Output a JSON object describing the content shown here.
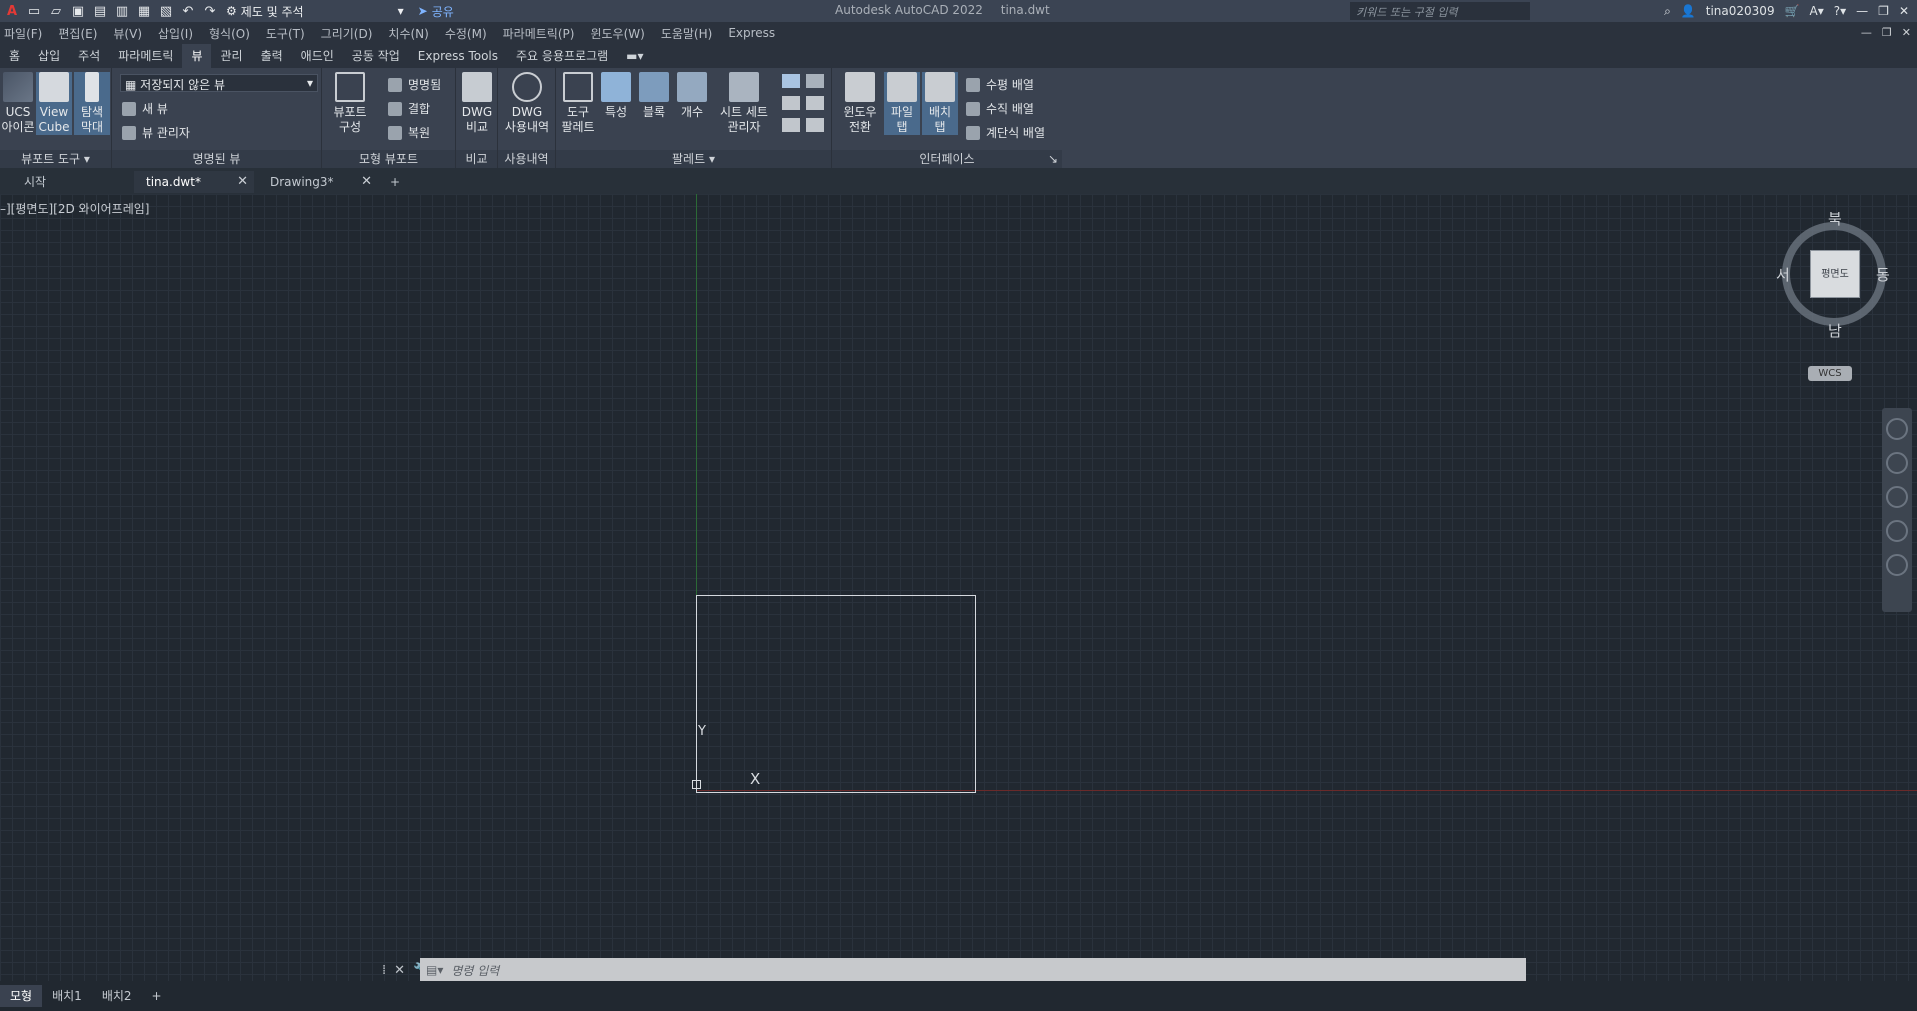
{
  "titlebar": {
    "workspace": "제도 및 주석",
    "share": "공유",
    "app_title": "Autodesk AutoCAD 2022",
    "file_title": "tina.dwt",
    "search_placeholder": "키워드 또는 구절 입력",
    "user": "tina020309"
  },
  "menu": [
    "파일(F)",
    "편집(E)",
    "뷰(V)",
    "삽입(I)",
    "형식(O)",
    "도구(T)",
    "그리기(D)",
    "치수(N)",
    "수정(M)",
    "파라메트릭(P)",
    "윈도우(W)",
    "도움말(H)",
    "Express"
  ],
  "ribbon_tabs": [
    {
      "label": "홈",
      "active": false
    },
    {
      "label": "삽입",
      "active": false
    },
    {
      "label": "주석",
      "active": false
    },
    {
      "label": "파라메트릭",
      "active": false
    },
    {
      "label": "뷰",
      "active": true
    },
    {
      "label": "관리",
      "active": false
    },
    {
      "label": "출력",
      "active": false
    },
    {
      "label": "애드인",
      "active": false
    },
    {
      "label": "공동 작업",
      "active": false
    },
    {
      "label": "Express Tools",
      "active": false
    },
    {
      "label": "주요 응용프로그램",
      "active": false
    }
  ],
  "ribbon": {
    "viewport_tools": {
      "title": "뷰포트 도구",
      "ucs_icon": "UCS\n아이콘",
      "view_cube": "View\nCube",
      "nav_bar": "탐색\n막대"
    },
    "named_views": {
      "title": "명명된 뷰",
      "combo": "저장되지 않은 뷰",
      "new_view": "새 뷰",
      "view_manager": "뷰 관리자"
    },
    "model_viewports": {
      "title": "모형 뷰포트",
      "config": "뷰포트\n구성",
      "named": "명명됨",
      "join": "결합",
      "restore": "복원"
    },
    "compare": {
      "title": "비교",
      "dwg_compare": "DWG\n비교"
    },
    "history": {
      "title": "사용내역",
      "dwg_history": "DWG\n사용내역"
    },
    "palettes": {
      "title": "팔레트",
      "tool_palettes": "도구\n팔레트",
      "properties": "특성",
      "blocks": "블록",
      "count": "개수",
      "sheet_set": "시트 세트\n관리자"
    },
    "interface": {
      "title": "인터페이스",
      "switch_windows": "윈도우\n전환",
      "file_tabs": "파일\n탭",
      "layout_tabs": "배치\n탭",
      "tile_horizontal": "수평 배열",
      "tile_vertical": "수직 배열",
      "cascade": "계단식 배열"
    }
  },
  "doc_tabs": {
    "start": "시작",
    "tab1": "tina.dwt*",
    "tab2": "Drawing3*"
  },
  "viewport_label": "–][평면도][2D 와이어프레임]",
  "viewcube": {
    "face": "평면도",
    "north": "북",
    "south": "남",
    "east": "동",
    "west": "서",
    "wcs": "WCS"
  },
  "ucs": {
    "x": "X",
    "y": "Y"
  },
  "command_line": {
    "placeholder": "명령 입력"
  },
  "layout_tabs": [
    {
      "label": "모형",
      "active": true
    },
    {
      "label": "배치1",
      "active": false
    },
    {
      "label": "배치2",
      "active": false
    }
  ],
  "colors": {
    "canvas": "#212830",
    "ribbon": "#3a4250",
    "accent": "#1e88e5"
  }
}
